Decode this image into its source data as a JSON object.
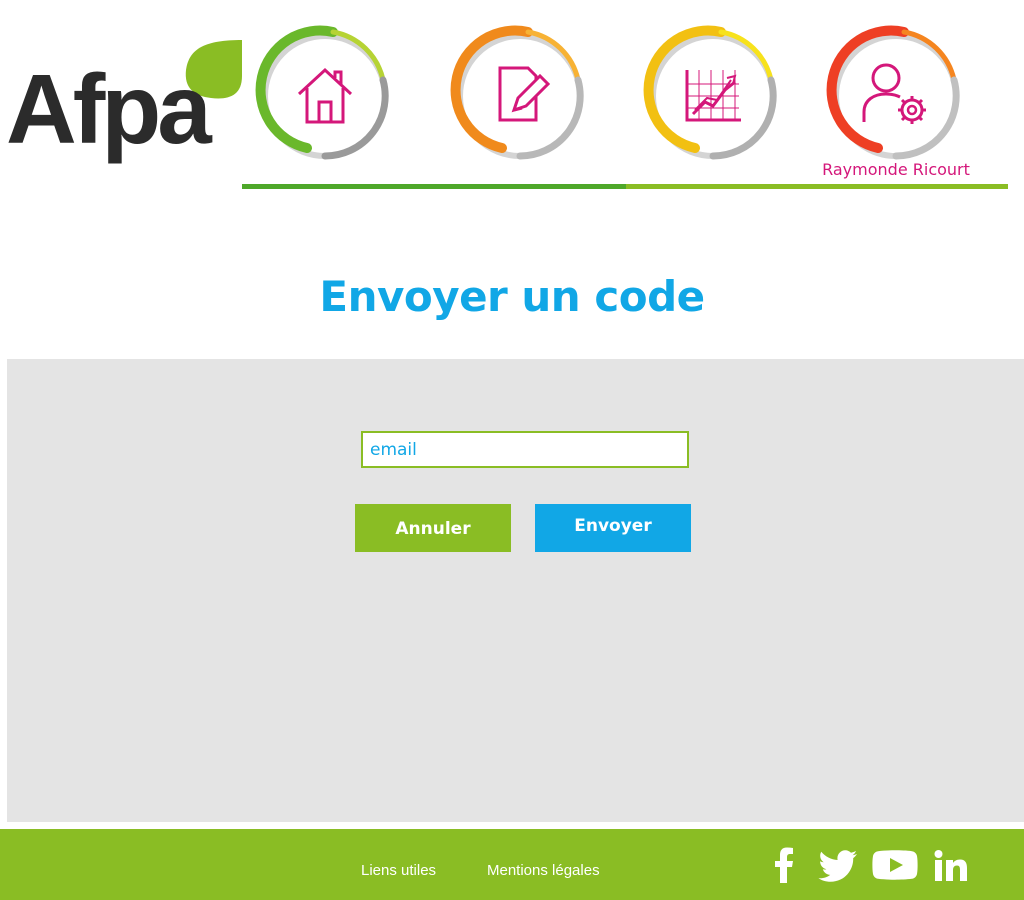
{
  "brand": {
    "logo_text": "Afpa"
  },
  "colors": {
    "green": "#8abd24",
    "green_dark": "#4ea82a",
    "blue": "#11a7e6",
    "magenta": "#d4177a",
    "panel_gray": "#e4e4e4",
    "logo_dark": "#2b2b2b"
  },
  "nav": {
    "items": [
      {
        "icon": "home-icon",
        "ring_colors": [
          "#6ab82b",
          "#b6d334"
        ]
      },
      {
        "icon": "edit-document-icon",
        "ring_colors": [
          "#f08a1c",
          "#f7b234"
        ]
      },
      {
        "icon": "line-chart-icon",
        "ring_colors": [
          "#f2c012",
          "#f7e21c"
        ]
      },
      {
        "icon": "user-settings-icon",
        "ring_colors": [
          "#ee3f24",
          "#f5851f"
        ]
      }
    ],
    "user_name": "Raymonde Ricourt"
  },
  "page": {
    "title": "Envoyer un code"
  },
  "form": {
    "email_placeholder": "email",
    "email_value": "",
    "cancel_label": "Annuler",
    "send_label": "Envoyer"
  },
  "footer": {
    "links": [
      "Liens utiles",
      "Mentions légales"
    ],
    "social": [
      "facebook-icon",
      "twitter-icon",
      "youtube-icon",
      "linkedin-icon"
    ]
  }
}
